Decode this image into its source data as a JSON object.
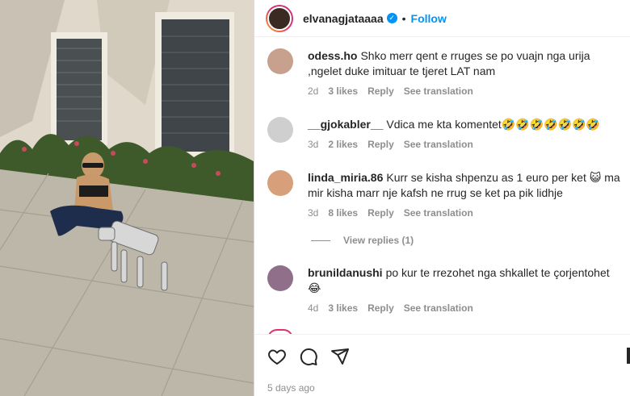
{
  "post": {
    "username": "elvanagjataaaa",
    "verified": true,
    "follow_label": "Follow",
    "separator": "•"
  },
  "comments": [
    {
      "user": "odess.ho",
      "text": "Shko merr qent e rruges se po vuajn nga urija ,ngelet duke imituar te tjeret LAT nam",
      "age": "2d",
      "likes": "3 likes",
      "reply": "Reply",
      "translate": "See translation"
    },
    {
      "user": "__gjokabler__",
      "text": "Vdica me kta komentet🤣🤣🤣🤣🤣🤣🤣",
      "age": "3d",
      "likes": "2 likes",
      "reply": "Reply",
      "translate": "See translation"
    },
    {
      "user": "linda_miria.86",
      "text": "Kurr se kisha shpenzu as 1 euro per ket 😺 ma mir kisha marr nje kafsh ne rrug se ket pa pik lidhje",
      "age": "3d",
      "likes": "8 likes",
      "reply": "Reply",
      "translate": "See translation",
      "view_replies": "View replies (1)"
    },
    {
      "user": "brunildanushi",
      "text": "po kur te rrezohet nga shkallet te çorjentohet 😂",
      "age": "4d",
      "likes": "3 likes",
      "reply": "Reply",
      "translate": "See translation"
    }
  ],
  "actions": {
    "icons": [
      "heart-icon",
      "comment-icon",
      "share-icon",
      "bookmark-icon"
    ],
    "time_ago": "5 days ago"
  },
  "colors": {
    "link_blue": "#0095f6",
    "muted": "#8e8e8e",
    "text": "#262626"
  }
}
